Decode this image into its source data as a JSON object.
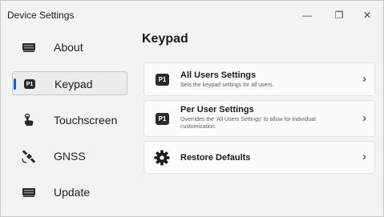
{
  "window": {
    "title": "Device Settings",
    "controls": {
      "minimize": "—",
      "maximize": "❐",
      "close": "✕"
    }
  },
  "sidebar": {
    "items": [
      {
        "label": "About",
        "icon": "keyboard-icon",
        "selected": false
      },
      {
        "label": "Keypad",
        "icon": "p1-key-icon",
        "selected": true
      },
      {
        "label": "Touchscreen",
        "icon": "touch-hand-icon",
        "selected": false
      },
      {
        "label": "GNSS",
        "icon": "satellite-icon",
        "selected": false
      },
      {
        "label": "Update",
        "icon": "keyboard-icon",
        "selected": false
      }
    ]
  },
  "main": {
    "title": "Keypad",
    "cards": [
      {
        "icon": "p1-key-icon",
        "icon_text": "P1",
        "title": "All Users Settings",
        "description": "Sets the keypad settings for all users."
      },
      {
        "icon": "p1-key-icon",
        "icon_text": "P1",
        "title": "Per User Settings",
        "description": "Overrides the 'All Users Settings' to allow for individual customization."
      },
      {
        "icon": "gear-icon",
        "title": "Restore Defaults",
        "description": ""
      }
    ],
    "chevron": "›"
  },
  "colors": {
    "accent": "#0a63c9",
    "background": "#f3f3f3",
    "card": "#fbfbfb"
  }
}
